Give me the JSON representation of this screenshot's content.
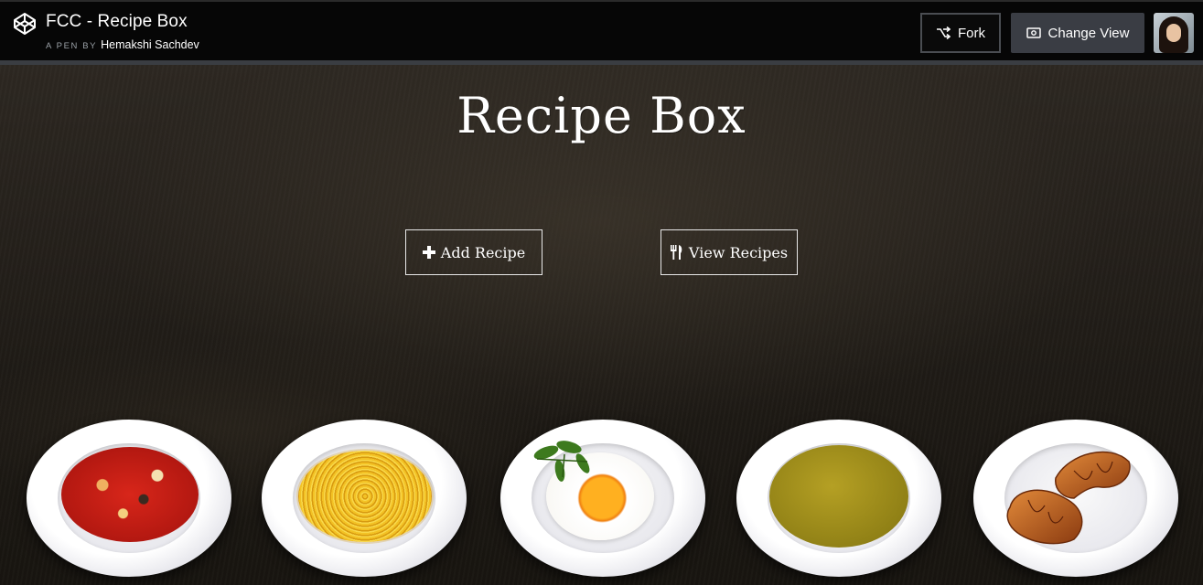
{
  "header": {
    "pen_title": "FCC - Recipe Box",
    "by_label": "A PEN BY",
    "author": "Hemakshi Sachdev",
    "fork_label": "Fork",
    "change_view_label": "Change View"
  },
  "app": {
    "title": "Recipe Box",
    "add_label": "Add Recipe",
    "view_label": "View Recipes"
  },
  "dishes": [
    "minestrone-soup",
    "spaghetti",
    "fried-egg",
    "pea-soup",
    "croissants"
  ],
  "colors": {
    "header_bg": "#060606",
    "button_gray": "#3a3d44",
    "accent": "#ffffff"
  }
}
